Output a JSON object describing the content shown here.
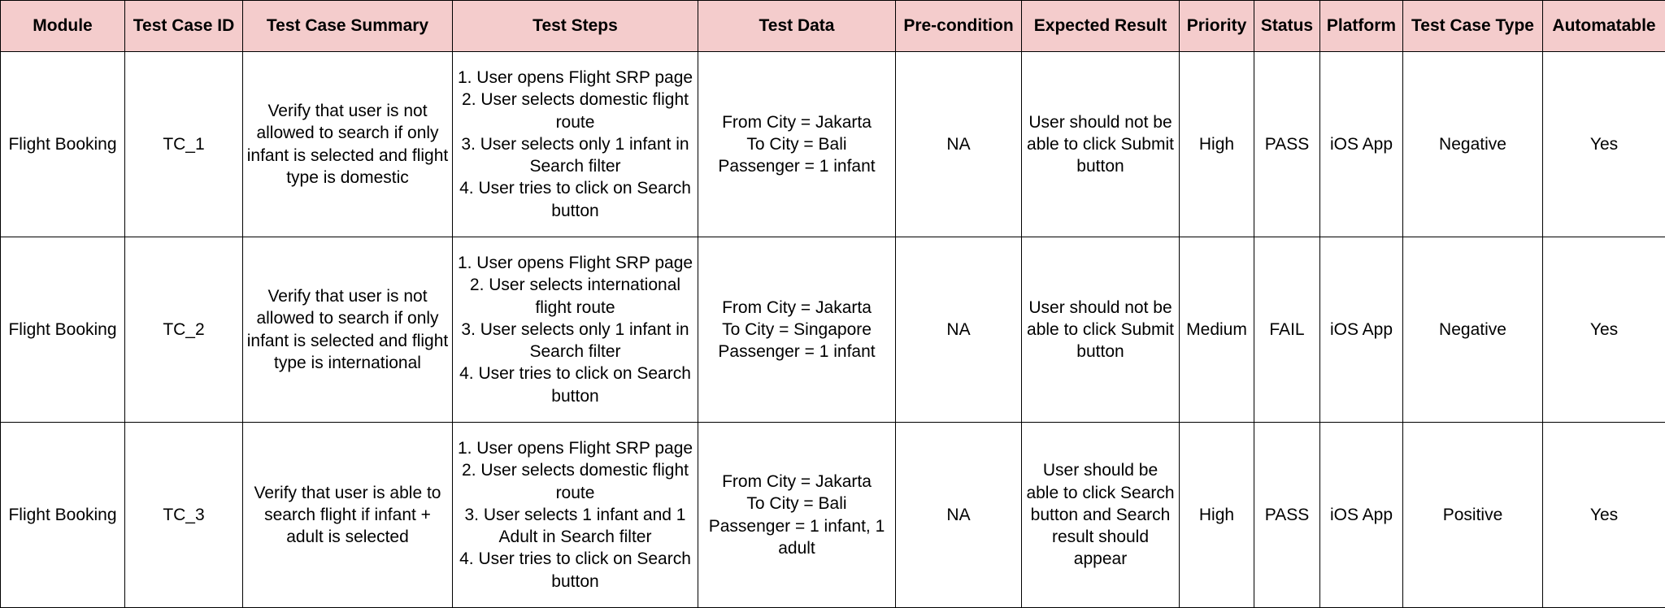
{
  "table": {
    "columns": [
      "Module",
      "Test Case ID",
      "Test Case Summary",
      "Test Steps",
      "Test Data",
      "Pre-condition",
      "Expected Result",
      "Priority",
      "Status",
      "Platform",
      "Test Case Type",
      "Automatable"
    ],
    "header_color": "#f4cccc",
    "rows": [
      {
        "module": "Flight Booking",
        "test_case_id": "TC_1",
        "summary": "Verify that user is not allowed to search if only infant is selected and flight type is domestic",
        "steps": "1. User opens Flight SRP page\n2. User selects domestic flight route\n3. User selects only 1 infant in Search filter\n4. User tries to click on Search button",
        "test_data": "From City = Jakarta\nTo City = Bali\nPassenger = 1 infant",
        "precondition": "NA",
        "expected_result": "User should not be able to click Submit button",
        "priority": "High",
        "status": "PASS",
        "platform": "iOS App",
        "test_case_type": "Negative",
        "automatable": "Yes"
      },
      {
        "module": "Flight Booking",
        "test_case_id": "TC_2",
        "summary": "Verify that user is not allowed to search if only infant is selected and flight type is international",
        "steps": "1. User opens Flight SRP page\n2. User selects international flight route\n3. User selects only 1 infant in Search filter\n4. User tries to click on Search button",
        "test_data": "From City = Jakarta\nTo City = Singapore\nPassenger = 1 infant",
        "precondition": "NA",
        "expected_result": "User should not be able to click Submit button",
        "priority": "Medium",
        "status": "FAIL",
        "platform": "iOS App",
        "test_case_type": "Negative",
        "automatable": "Yes"
      },
      {
        "module": "Flight Booking",
        "test_case_id": "TC_3",
        "summary": "Verify that user is able to search flight if infant + adult is selected",
        "steps": "1. User opens Flight SRP page\n2. User selects domestic flight route\n3. User selects 1 infant and 1 Adult in Search filter\n4. User tries to click on Search button",
        "test_data": "From City = Jakarta\nTo City = Bali\nPassenger = 1 infant, 1 adult",
        "precondition": "NA",
        "expected_result": "User should be able to click Search button and Search result should appear",
        "priority": "High",
        "status": "PASS",
        "platform": "iOS App",
        "test_case_type": "Positive",
        "automatable": "Yes"
      }
    ]
  }
}
